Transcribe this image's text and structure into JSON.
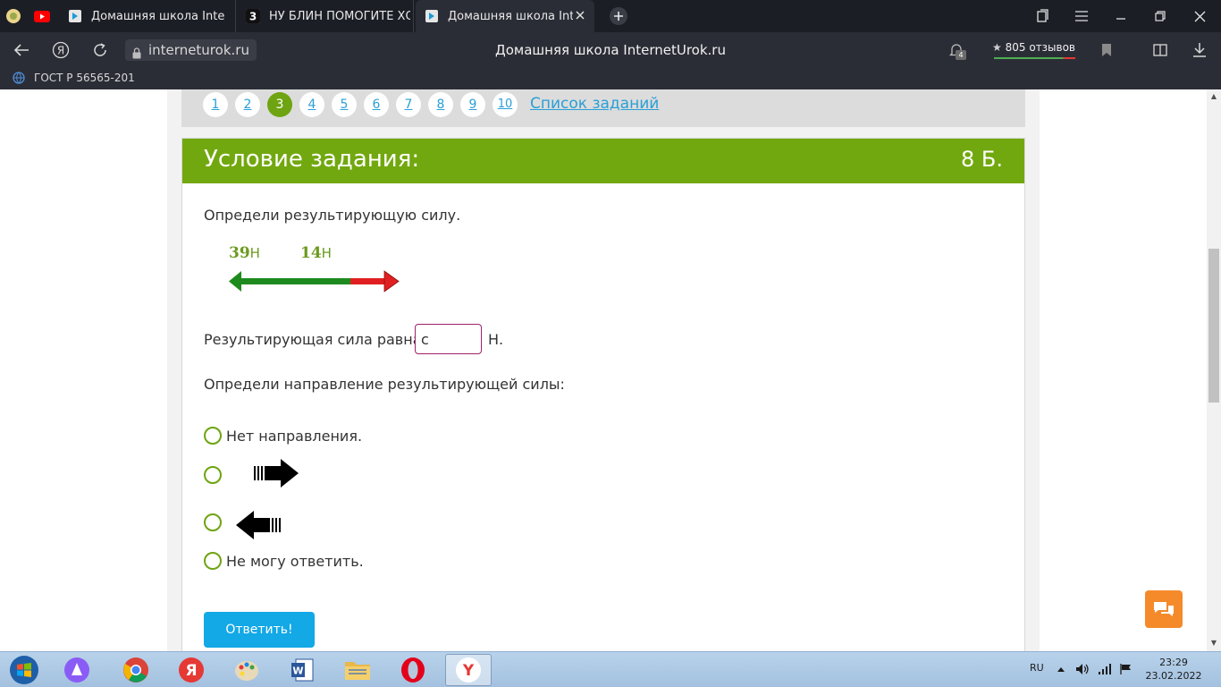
{
  "browser": {
    "tabs": [
      {
        "title": "Домашняя школа Internet"
      },
      {
        "title": "НУ БЛИН ПОМОГИТЕ ХОТ"
      },
      {
        "title": "Домашняя школа Intern"
      }
    ],
    "url": "interneturok.ru",
    "page_title": "Домашняя школа InternetUrok.ru",
    "reviews_label": "805 отзывов",
    "notification_count": "4",
    "bookmark_label": "ГОСТ Р 56565-201"
  },
  "question_nav": {
    "numbers": [
      "1",
      "2",
      "3",
      "4",
      "5",
      "6",
      "7",
      "8",
      "9",
      "10"
    ],
    "current": "3",
    "task_list_label": "Список заданий"
  },
  "task": {
    "header_title": "Условие задания:",
    "points": "8 Б.",
    "prompt": "Определи результирующую силу.",
    "force_left_value": "39",
    "force_left_unit": "Н",
    "force_right_value": "14",
    "force_right_unit": "Н",
    "result_label": "Результирующая сила равна",
    "result_value": "с",
    "result_unit": "Н.",
    "direction_prompt": "Определи направление результирующей силы:",
    "options": [
      {
        "label": "Нет направления."
      },
      {
        "label": ""
      },
      {
        "label": ""
      },
      {
        "label": "Не могу ответить."
      }
    ],
    "submit_label": "Ответить!"
  },
  "taskbar": {
    "lang": "RU",
    "time": "23:29",
    "date": "23.02.2022"
  },
  "colors": {
    "accent_green": "#72a80f",
    "link_blue": "#2a9fd6",
    "button_blue": "#13a8e6",
    "force_green": "#1e8a1e",
    "force_red": "#e02020",
    "input_border": "#a0216a",
    "chat_orange": "#f58a2b"
  }
}
